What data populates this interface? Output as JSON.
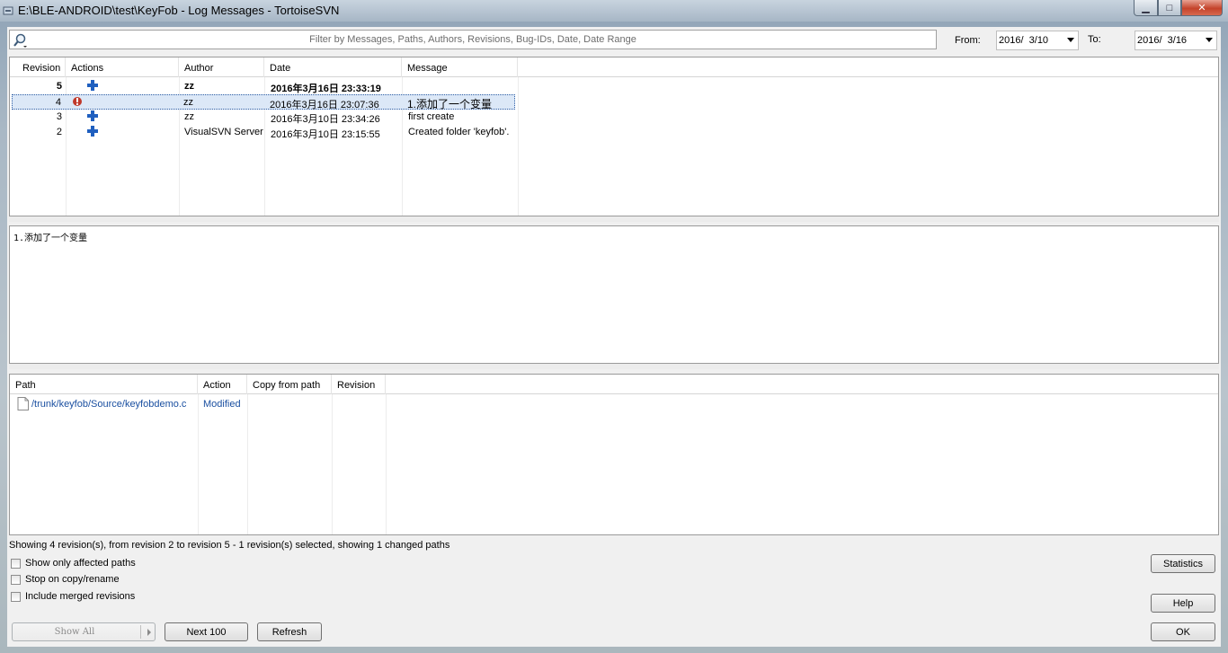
{
  "window": {
    "title": "E:\\BLE-ANDROID\\test\\KeyFob - Log Messages - TortoiseSVN",
    "min_glyph": "▁",
    "max_glyph": "□",
    "close_glyph": "✕"
  },
  "filter": {
    "placeholder": "Filter by Messages, Paths, Authors, Revisions, Bug-IDs, Date, Date Range",
    "from_label": "From:",
    "from_value": "2016/  3/10",
    "to_label": "To:",
    "to_value": "2016/  3/16"
  },
  "log": {
    "columns": [
      "Revision",
      "Actions",
      "Author",
      "Date",
      "Message"
    ],
    "rows": [
      {
        "revision": "5",
        "author": "zz",
        "date": "2016年3月16日 23:33:19",
        "message": "",
        "bold": true,
        "selected": false,
        "icon": "add-icon"
      },
      {
        "revision": "4",
        "author": "zz",
        "date": "2016年3月16日 23:07:36",
        "message": "1.添加了一个变量",
        "bold": false,
        "selected": true,
        "icon": "modified-icon"
      },
      {
        "revision": "3",
        "author": "zz",
        "date": "2016年3月10日 23:34:26",
        "message": "first create",
        "bold": false,
        "selected": false,
        "icon": "add-icon"
      },
      {
        "revision": "2",
        "author": "VisualSVN Server",
        "date": "2016年3月10日 23:15:55",
        "message": "Created folder 'keyfob'.",
        "bold": false,
        "selected": false,
        "icon": "add-icon"
      }
    ]
  },
  "message_text": "1.添加了一个变量",
  "paths": {
    "columns": [
      "Path",
      "Action",
      "Copy from path",
      "Revision"
    ],
    "rows": [
      {
        "path": "/trunk/keyfob/Source/keyfobdemo.c",
        "action": "Modified",
        "copy_from": "",
        "revision": ""
      }
    ]
  },
  "status_text": "Showing 4 revision(s), from revision 2 to revision 5 - 1 revision(s) selected, showing 1 changed paths",
  "options": {
    "affected_paths": "Show only affected paths",
    "stop_on_copy": "Stop on copy/rename",
    "include_merged": "Include merged revisions"
  },
  "buttons": {
    "show_all": "Show All",
    "next_100": "Next 100",
    "refresh": "Refresh",
    "statistics": "Statistics",
    "help": "Help",
    "ok": "OK"
  },
  "colors": {
    "selection": "#dce8f7",
    "link": "#1a4fa0",
    "add_icon": "#1f5fbf",
    "modified_icon": "#c0392b"
  }
}
